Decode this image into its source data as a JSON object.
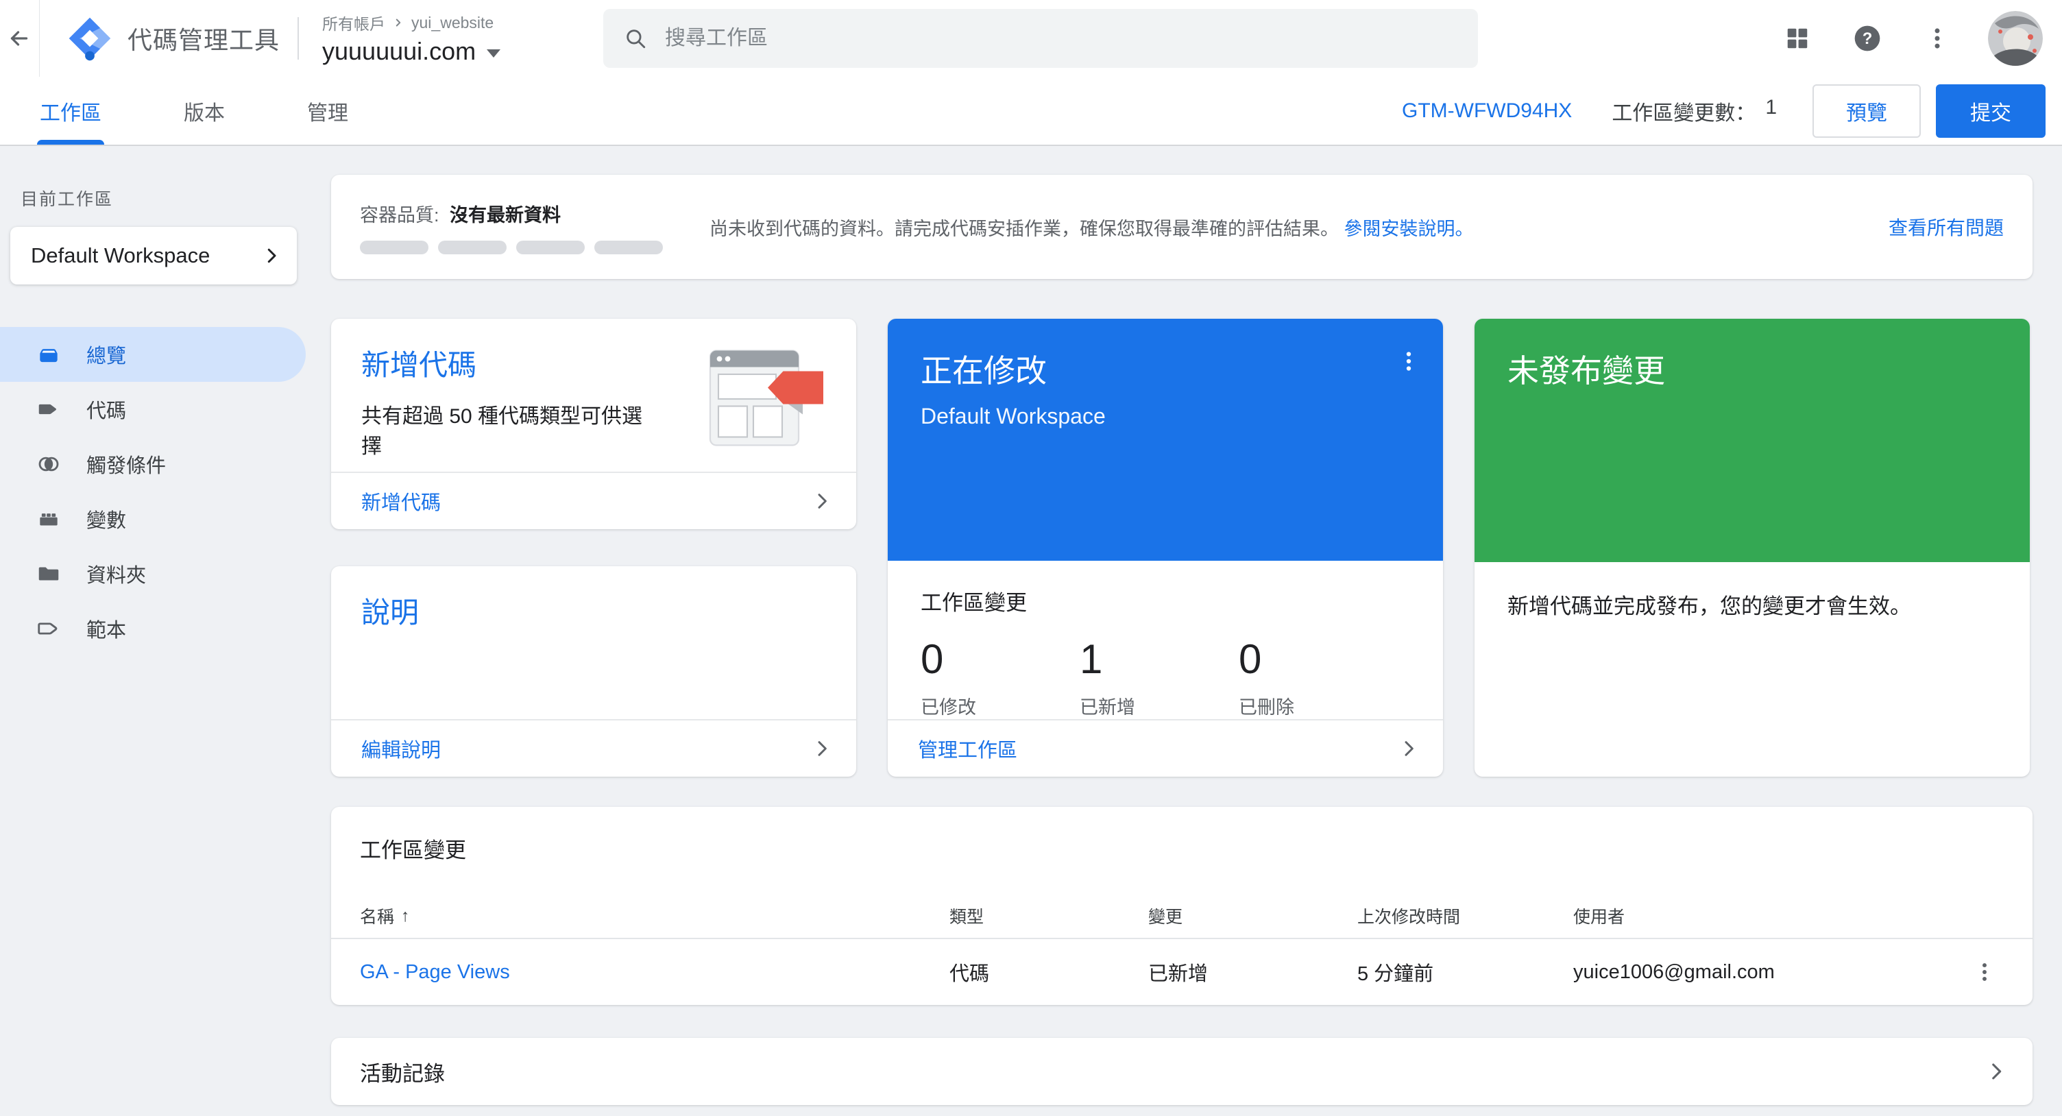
{
  "colors": {
    "accent": "#1a73e8",
    "editing_card": "#1a73e8",
    "unpublished_card": "#34a853",
    "sidebar_active_bg": "#d2e3fc",
    "page_background": "#eff1f4",
    "muted_text": "#5f6368",
    "tag_red": "#e8594a"
  },
  "icons": {
    "help_glyph": "?",
    "sort_asc_glyph": "↑"
  },
  "header": {
    "app_title": "代碼管理工具",
    "breadcrumb_all_accounts": "所有帳戶",
    "breadcrumb_account": "yui_website",
    "container_domain": "yuuuuuui.com",
    "search_placeholder": "搜尋工作區"
  },
  "tabbar": {
    "tabs": [
      {
        "label": "工作區"
      },
      {
        "label": "版本"
      },
      {
        "label": "管理"
      }
    ],
    "container_id": "GTM-WFWD94HX",
    "changes_count_label": "工作區變更數：",
    "changes_count_value": "1",
    "preview_button": "預覽",
    "submit_button": "提交"
  },
  "sidebar": {
    "current_workspace_label": "目前工作區",
    "workspace_name": "Default Workspace",
    "items": [
      {
        "label": "總覽"
      },
      {
        "label": "代碼"
      },
      {
        "label": "觸發條件"
      },
      {
        "label": "變數"
      },
      {
        "label": "資料夾"
      },
      {
        "label": "範本"
      }
    ]
  },
  "quality_banner": {
    "title_label": "容器品質:",
    "title_value": "沒有最新資料",
    "message": "尚未收到代碼的資料。請完成代碼安插作業，確保您取得最準確的評估結果。",
    "install_link": "參閱安裝說明。",
    "view_all_link": "查看所有問題"
  },
  "cards": {
    "new_tag": {
      "title": "新增代碼",
      "description": "共有超過 50 種代碼類型可供選擇",
      "footer_link": "新增代碼"
    },
    "description_card": {
      "title": "說明",
      "footer_link": "編輯說明"
    },
    "editing": {
      "title": "正在修改",
      "workspace": "Default Workspace",
      "section_title": "工作區變更",
      "stats": [
        {
          "value": "0",
          "label": "已修改"
        },
        {
          "value": "1",
          "label": "已新增"
        },
        {
          "value": "0",
          "label": "已刪除"
        }
      ],
      "footer_link": "管理工作區"
    },
    "unpublished": {
      "title": "未發布變更",
      "description": "新增代碼並完成發布，您的變更才會生效。"
    }
  },
  "changes_table": {
    "title": "工作區變更",
    "columns": [
      "名稱",
      "類型",
      "變更",
      "上次修改時間",
      "使用者"
    ],
    "rows": [
      {
        "name": "GA - Page Views",
        "type": "代碼",
        "change": "已新增",
        "modified": "5 分鐘前",
        "user": "yuice1006@gmail.com"
      }
    ]
  },
  "activity": {
    "title": "活動記錄"
  }
}
